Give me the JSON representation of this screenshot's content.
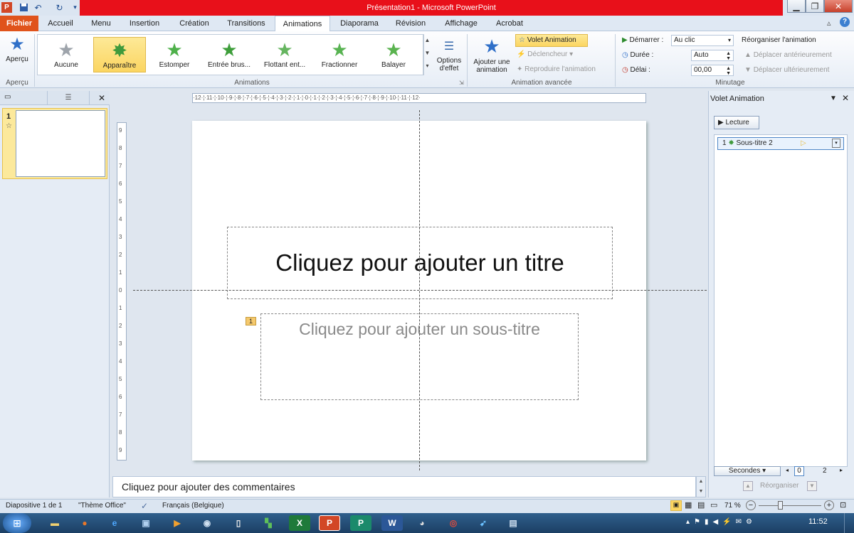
{
  "window": {
    "title": "Présentation1 - Microsoft PowerPoint"
  },
  "tabs": [
    "Fichier",
    "Accueil",
    "Menu",
    "Insertion",
    "Création",
    "Transitions",
    "Animations",
    "Diaporama",
    "Révision",
    "Affichage",
    "Acrobat"
  ],
  "ribbon": {
    "apercu": {
      "label": "Aperçu",
      "group": "Aperçu"
    },
    "animations": [
      {
        "label": "Aucune",
        "color": "#9ea4ab"
      },
      {
        "label": "Apparaître",
        "color": "#3f9a3c"
      },
      {
        "label": "Estomper",
        "color": "#4eb04a"
      },
      {
        "label": "Entrée brus...",
        "color": "#3e9e3b"
      },
      {
        "label": "Flottant ent...",
        "color": "#65b55f"
      },
      {
        "label": "Fractionner",
        "color": "#58b352"
      },
      {
        "label": "Balayer",
        "color": "#5ab34f"
      }
    ],
    "options_effet": {
      "line1": "Options",
      "line2": "d'effet"
    },
    "animations_group": "Animations",
    "ajouter": {
      "line1": "Ajouter une",
      "line2": "animation"
    },
    "volet_btn": "Volet Animation",
    "declencheur": "Déclencheur",
    "reproduire": "Reproduire l'animation",
    "anim_avancee_group": "Animation avancée",
    "demarrer_label": "Démarrer :",
    "demarrer_value": "Au clic",
    "duree_label": "Durée :",
    "duree_value": "Auto",
    "delai_label": "Délai :",
    "delai_value": "00,00",
    "reorganiser_title": "Réorganiser l'animation",
    "deplacer_ant": "Déplacer antérieurement",
    "deplacer_ult": "Déplacer ultérieurement",
    "minutage_group": "Minutage"
  },
  "slides_pane": {
    "slide_number": "1"
  },
  "slide": {
    "title_placeholder": "Cliquez pour ajouter un titre",
    "subtitle_placeholder": "Cliquez pour ajouter un sous-titre",
    "anim_badge": "1"
  },
  "ruler": {
    "h": "·12·¦·11·¦·10·¦·9·¦·8·¦·7·¦·6·¦·5·¦·4·¦·3·¦·2·¦·1·¦·0·¦·1·¦·2·¦·3·¦·4·¦·5·¦·6·¦·7·¦·8·¦·9·¦·10·¦·11·¦·12·",
    "v": [
      "9",
      "8",
      "7",
      "6",
      "5",
      "4",
      "3",
      "2",
      "1",
      "0",
      "1",
      "2",
      "3",
      "4",
      "5",
      "6",
      "7",
      "8",
      "9"
    ]
  },
  "notes_placeholder": "Cliquez pour ajouter des commentaires",
  "anim_pane": {
    "title": "Volet Animation",
    "lecture": "Lecture",
    "item_number": "1",
    "item_label": "Sous-titre 2",
    "seconds_label": "Secondes",
    "timeline_0": "0",
    "timeline_2": "2",
    "reorganiser": "Réorganiser"
  },
  "status": {
    "slide_info": "Diapositive 1 de 1",
    "theme": "\"Thème Office\"",
    "language": "Français (Belgique)",
    "zoom": "71 %",
    "zoom_level": 0.71
  },
  "taskbar": {
    "clock": "11:52"
  }
}
